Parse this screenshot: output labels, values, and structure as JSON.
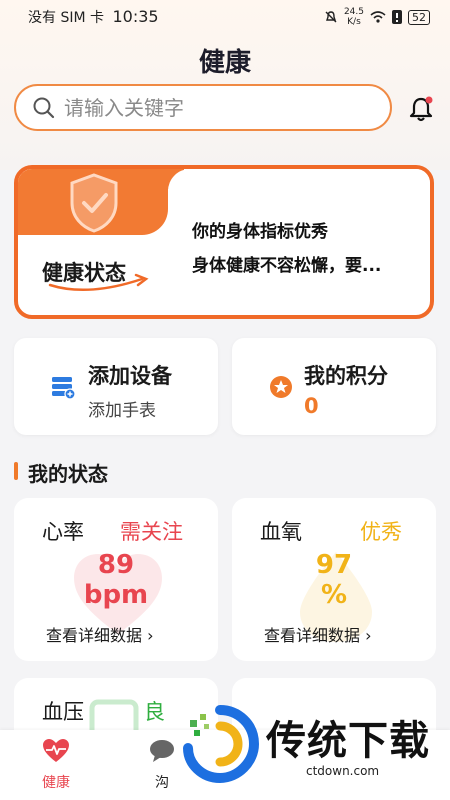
{
  "status_bar": {
    "carrier": "没有 SIM 卡",
    "time": "10:35",
    "net_speed_value": "24.5",
    "net_speed_unit": "K/s",
    "battery": "52"
  },
  "header": {
    "title": "健康",
    "search_placeholder": "请输入关键字"
  },
  "health_status": {
    "label": "健康状态",
    "message_1": "你的身体指标优秀",
    "message_2": "身体健康不容松懈，要..."
  },
  "device_card": {
    "title": "添加设备",
    "subtitle": "添加手表"
  },
  "points_card": {
    "title": "我的积分",
    "value": "0"
  },
  "section": {
    "title": "我的状态"
  },
  "metrics": {
    "heart": {
      "name": "心率",
      "status": "需关注",
      "value": "89",
      "unit": "bpm",
      "link": "查看详细数据 ›"
    },
    "oxygen": {
      "name": "血氧",
      "status": "优秀",
      "value": "97",
      "unit": "%",
      "link": "查看详细数据 ›"
    },
    "bp": {
      "name": "血压",
      "status": "良"
    }
  },
  "bottom_nav": {
    "health": "健康",
    "chat": "沟"
  },
  "brand": {
    "name": "传统下载",
    "url": "ctdown.com"
  },
  "colors": {
    "accent": "#f27a33",
    "alert": "#e8454f",
    "excellent": "#f1b318",
    "good": "#2fae3f"
  }
}
